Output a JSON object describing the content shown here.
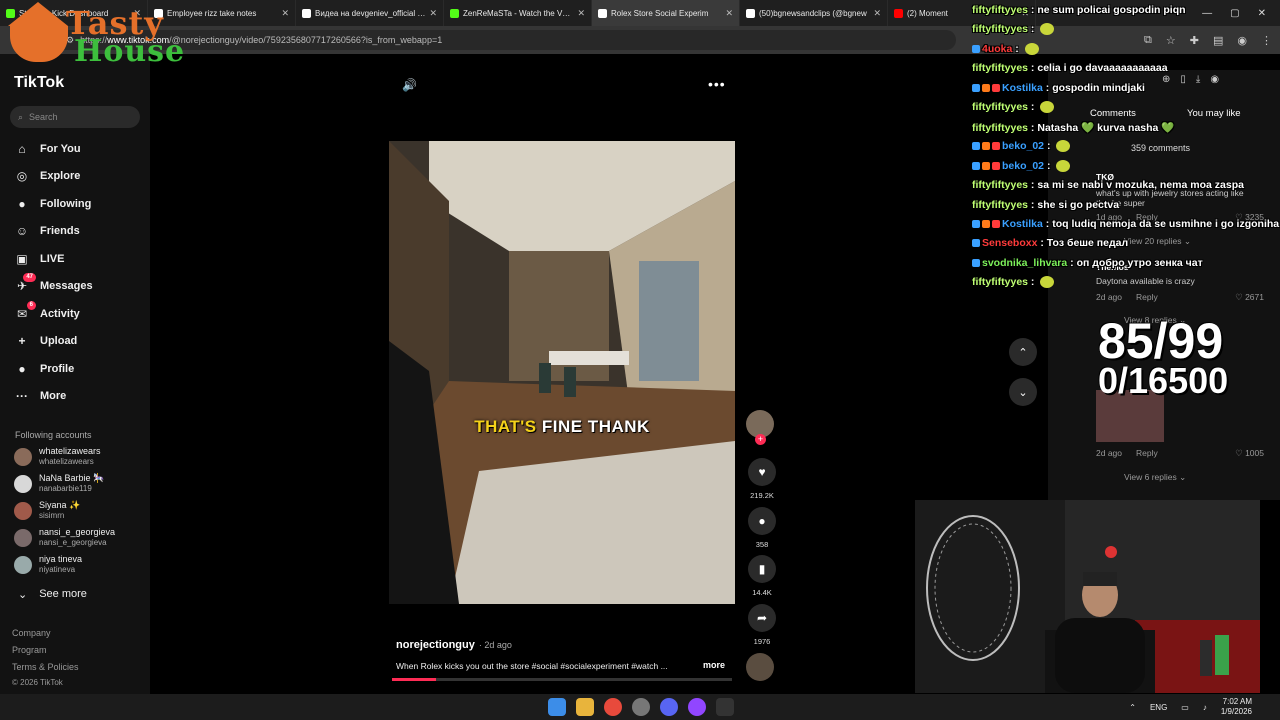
{
  "browser": {
    "tabs": [
      {
        "title": "Stream - Kick Dashboard",
        "color": "#53fc18",
        "active": false
      },
      {
        "title": "Employee rizz take notes",
        "color": "#ffffff",
        "active": false
      },
      {
        "title": "Видеа на devgeniev_official (@",
        "color": "#ffffff",
        "active": false
      },
      {
        "title": "ZenReMaSTa - Watch the VOD",
        "color": "#53fc18",
        "active": false
      },
      {
        "title": "Rolex Store Social Experim",
        "color": "#ffffff",
        "active": true
      },
      {
        "title": "(50)bgnewsandclips (@bgnew",
        "color": "#ffffff",
        "active": false
      },
      {
        "title": "(2) Moment",
        "color": "#ff0000",
        "active": false
      }
    ],
    "url_scheme": "https://",
    "url_host": "www.tiktok.com",
    "url_path": "/@norejectionguy/video/7592356807717260566?is_from_webapp=1"
  },
  "overlay_logo": {
    "line1": "Tasty",
    "line2": "House"
  },
  "tiktok": {
    "brand": "TikTok",
    "search_placeholder": "Search",
    "nav": [
      {
        "label": "For You",
        "icon": "home-icon",
        "glyph": "⌂",
        "badge": ""
      },
      {
        "label": "Explore",
        "icon": "compass-icon",
        "glyph": "◎",
        "badge": ""
      },
      {
        "label": "Following",
        "icon": "following-icon",
        "glyph": "●",
        "badge": ""
      },
      {
        "label": "Friends",
        "icon": "friends-icon",
        "glyph": "☺",
        "badge": ""
      },
      {
        "label": "LIVE",
        "icon": "live-icon",
        "glyph": "▣",
        "badge": ""
      },
      {
        "label": "Messages",
        "icon": "messages-icon",
        "glyph": "✈",
        "badge": "47"
      },
      {
        "label": "Activity",
        "icon": "activity-icon",
        "glyph": "✉",
        "badge": "6"
      },
      {
        "label": "Upload",
        "icon": "upload-icon",
        "glyph": "+",
        "badge": ""
      },
      {
        "label": "Profile",
        "icon": "profile-icon",
        "glyph": "●",
        "badge": ""
      },
      {
        "label": "More",
        "icon": "more-icon",
        "glyph": "···",
        "badge": ""
      }
    ],
    "following_header": "Following accounts",
    "following": [
      {
        "name": "whatelizawears",
        "user": "whatelizawears"
      },
      {
        "name": "NaNa Barbie 🎠",
        "user": "nanabarbie119"
      },
      {
        "name": "Siyana ✨",
        "user": "sisimrn"
      },
      {
        "name": "nansi_e_georgieva",
        "user": "nansi_e_georgieva"
      },
      {
        "name": "niya tineva",
        "user": "niyatineva"
      }
    ],
    "see_more": "See more",
    "footer": [
      "Company",
      "Program",
      "Terms & Policies",
      "© 2026 TikTok"
    ]
  },
  "video": {
    "subtitle_highlight": "THAT'S",
    "subtitle_rest": " FINE THANK",
    "author": "norejectionguy",
    "ago": "· 2d ago",
    "caption": "When Rolex kicks you out the store #social #socialexperiment #watch ...",
    "more": "more",
    "progress": 0.13,
    "likes": "219.2K",
    "comments": "358",
    "saves": "14.4K",
    "shares": "1976"
  },
  "comments_panel": {
    "tab_comments": "Comments",
    "tab_you_may_like": "You may like",
    "count": "359 comments",
    "items": [
      {
        "name": "TKØ",
        "text": "what's up with jewelry stores acting like they're super",
        "ago": "1d ago",
        "reply": "Reply",
        "likes": "3235",
        "view_replies": "View 20 replies"
      },
      {
        "name": "Themos",
        "text": "Daytona available is crazy",
        "ago": "2d ago",
        "reply": "Reply",
        "likes": "2671",
        "view_replies": "View 8 replies"
      },
      {
        "name": "",
        "text": "",
        "ago": "2d ago",
        "reply": "Reply",
        "likes": "1005",
        "view_replies": "View 6 replies"
      }
    ]
  },
  "chat": [
    {
      "user": "fiftyfiftyyes",
      "msg": "ne sum policai gospodin piqn",
      "ucolor": "u"
    },
    {
      "user": "fiftyfiftyyes",
      "msg": "",
      "ucolor": "u"
    },
    {
      "user": "4uoka",
      "msg": "",
      "ucolor": "ur"
    },
    {
      "user": "fiftyfiftyyes",
      "msg": "celia i go davaaaaaaaaaaa",
      "ucolor": "u"
    },
    {
      "user": "Kostilka",
      "msg": "gospodin mindjaki",
      "ucolor": "ub"
    },
    {
      "user": "fiftyfiftyyes",
      "msg": "",
      "ucolor": "u"
    },
    {
      "user": "fiftyfiftyyes",
      "msg": "Natasha 💚 kurva nasha 💚",
      "ucolor": "u"
    },
    {
      "user": "beko_02",
      "msg": "",
      "ucolor": "ub"
    },
    {
      "user": "beko_02",
      "msg": "",
      "ucolor": "ub"
    },
    {
      "user": "fiftyfiftyyes",
      "msg": "sa mi se nabi v mozuka, nema moa zaspa",
      "ucolor": "u"
    },
    {
      "user": "fiftyfiftyyes",
      "msg": "she si go pectva",
      "ucolor": "u"
    },
    {
      "user": "Kostilka",
      "msg": "toq ludiq nemoja da se usmihne i go izgoniha",
      "ucolor": "ub"
    },
    {
      "user": "Senseboxx",
      "msg": "Тоз беше педал",
      "ucolor": "ur"
    },
    {
      "user": "svodnika_lihvara",
      "msg": "оп добро утро зенка чат",
      "ucolor": "ug"
    },
    {
      "user": "fiftyfiftyyes",
      "msg": "",
      "ucolor": "u"
    }
  ],
  "counter": {
    "line1": "85/99",
    "line2": "0/16500"
  },
  "taskbar": {
    "lang": "ENG",
    "time": "7:02 AM",
    "date": "1/9/2026"
  }
}
